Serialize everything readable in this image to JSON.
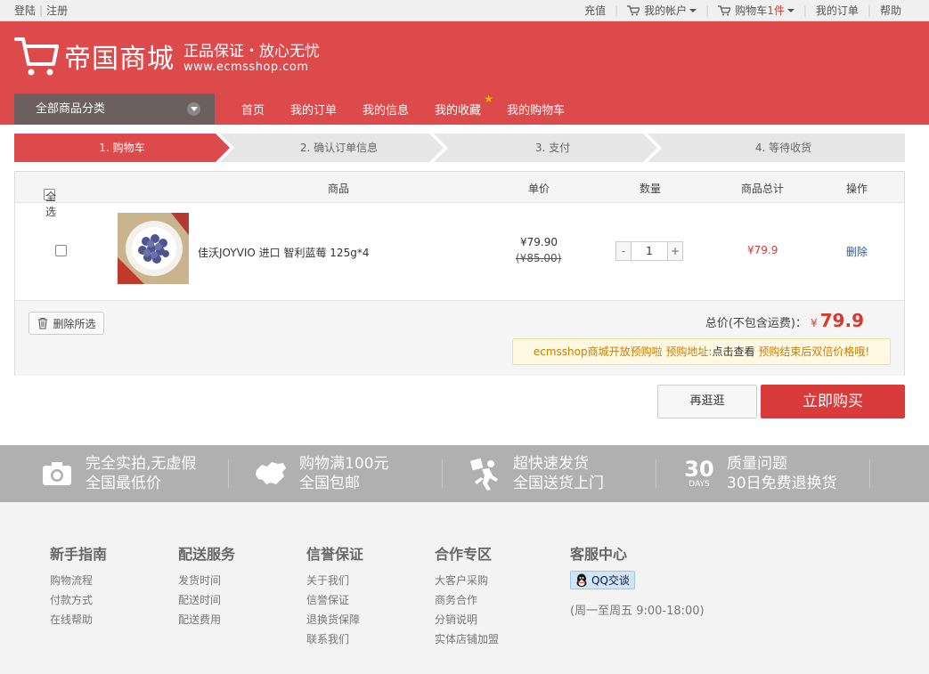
{
  "topbar": {
    "login": "登陆",
    "register": "注册",
    "recharge": "充值",
    "account": "我的帐户",
    "cart_label": "购物车",
    "cart_count": "1件",
    "my_orders": "我的订单",
    "help": "帮助"
  },
  "header": {
    "brand": "帝国商城",
    "slogan": "正品保证・放心无忧",
    "site": "www.ecmsshop.com",
    "category_button": "全部商品分类",
    "nav": [
      "首页",
      "我的订单",
      "我的信息",
      "我的收藏",
      "我的购物车"
    ]
  },
  "steps": [
    "1. 购物车",
    "2. 确认订单信息",
    "3. 支付",
    "4. 等待收货"
  ],
  "cart": {
    "headers": {
      "select_all": "全选",
      "product": "商品",
      "unit_price": "单价",
      "quantity": "数量",
      "subtotal": "商品总计",
      "action": "操作"
    },
    "item": {
      "name": "佳沃JOYVIO 进口 智利蓝莓 125g*4",
      "price": "¥79.90",
      "original_price": "(¥85.00)",
      "quantity": "1",
      "minus": "-",
      "plus": "+",
      "subtotal": "¥79.9",
      "delete": "删除"
    },
    "delete_selected": "删除所选",
    "total_label": "总价(不包含运费)：",
    "total_currency": "¥",
    "total_amount": "79.9",
    "notice": {
      "part1": "ecmsshop商城开放预购啦 预购地址:",
      "part2": "点击查看",
      "part3": "预购结束后双倍价格哦!"
    }
  },
  "buttons": {
    "continue": "再逛逛",
    "buy_now": "立即购买"
  },
  "services": [
    {
      "icon": "camera-icon",
      "line1": "完全实拍,无虚假",
      "line2": "全国最低价"
    },
    {
      "icon": "china-map-icon",
      "line1": "购物满100元",
      "line2": "全国包邮"
    },
    {
      "icon": "delivery-man-icon",
      "line1": "超快速发货",
      "line2": "全国送货上门"
    },
    {
      "icon": "30-days-icon",
      "badge_num": "30",
      "badge_text": "DAYS",
      "line1": "质量问题",
      "line2": "30日免费退换货"
    }
  ],
  "footer": {
    "columns": [
      {
        "title": "新手指南",
        "links": [
          "购物流程",
          "付款方式",
          "在线帮助"
        ]
      },
      {
        "title": "配送服务",
        "links": [
          "发货时间",
          "配送时间",
          "配送费用"
        ]
      },
      {
        "title": "信誉保证",
        "links": [
          "关于我们",
          "信誉保证",
          "退换货保障",
          "联系我们"
        ]
      },
      {
        "title": "合作专区",
        "links": [
          "大客户采购",
          "商务合作",
          "分销说明",
          "实体店铺加盟"
        ]
      }
    ],
    "service_center": {
      "title": "客服中心",
      "qq_label": "QQ交谈",
      "hours": "(周一至周五 9:00-18:00)"
    }
  },
  "colors": {
    "brand_red": "#dd4a4b",
    "price_red": "#d9392f",
    "service_gray": "#b0b0b0"
  }
}
